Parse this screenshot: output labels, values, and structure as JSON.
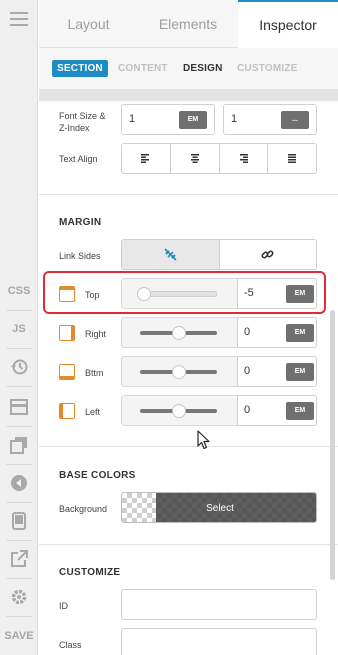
{
  "rail": {
    "css_label": "CSS",
    "js_label": "JS",
    "save_label": "SAVE",
    "icons": [
      "menu-icon",
      "history-icon",
      "layout-block-icon",
      "copy-icon",
      "play-icon",
      "mobile-icon",
      "external-link-icon",
      "gear-icon"
    ]
  },
  "tabs": [
    "Layout",
    "Elements",
    "Inspector"
  ],
  "subtabs": [
    "SECTION",
    "CONTENT",
    "DESIGN",
    "CUSTOMIZE"
  ],
  "typography": {
    "font_size_label": "Font Size &\nZ-Index",
    "font_size_value": "1",
    "font_size_unit": "EM",
    "z_index_value": "1",
    "z_index_unit": "...",
    "text_align_label": "Text Align",
    "align_options": [
      "align-left-icon",
      "align-center-icon",
      "align-right-icon",
      "align-justify-icon"
    ]
  },
  "margin": {
    "heading": "MARGIN",
    "link_sides_label": "Link Sides",
    "link_options": [
      "unlink-icon",
      "link-icon"
    ],
    "sides": [
      {
        "label": "Top",
        "value": "-5",
        "unit": "EM",
        "slider": 0.0
      },
      {
        "label": "Right",
        "value": "0",
        "unit": "EM",
        "slider": 0.5
      },
      {
        "label": "Bttm",
        "value": "0",
        "unit": "EM",
        "slider": 0.5
      },
      {
        "label": "Left",
        "value": "0",
        "unit": "EM",
        "slider": 0.5
      }
    ]
  },
  "base_colors": {
    "heading": "BASE COLORS",
    "background_label": "Background",
    "select_label": "Select"
  },
  "customize": {
    "heading": "CUSTOMIZE",
    "id_label": "ID",
    "id_value": "",
    "class_label": "Class",
    "class_value": ""
  },
  "colors": {
    "accent": "#1e8bc3",
    "highlight": "#e02a3a",
    "side_icon": "#e58a2c"
  }
}
